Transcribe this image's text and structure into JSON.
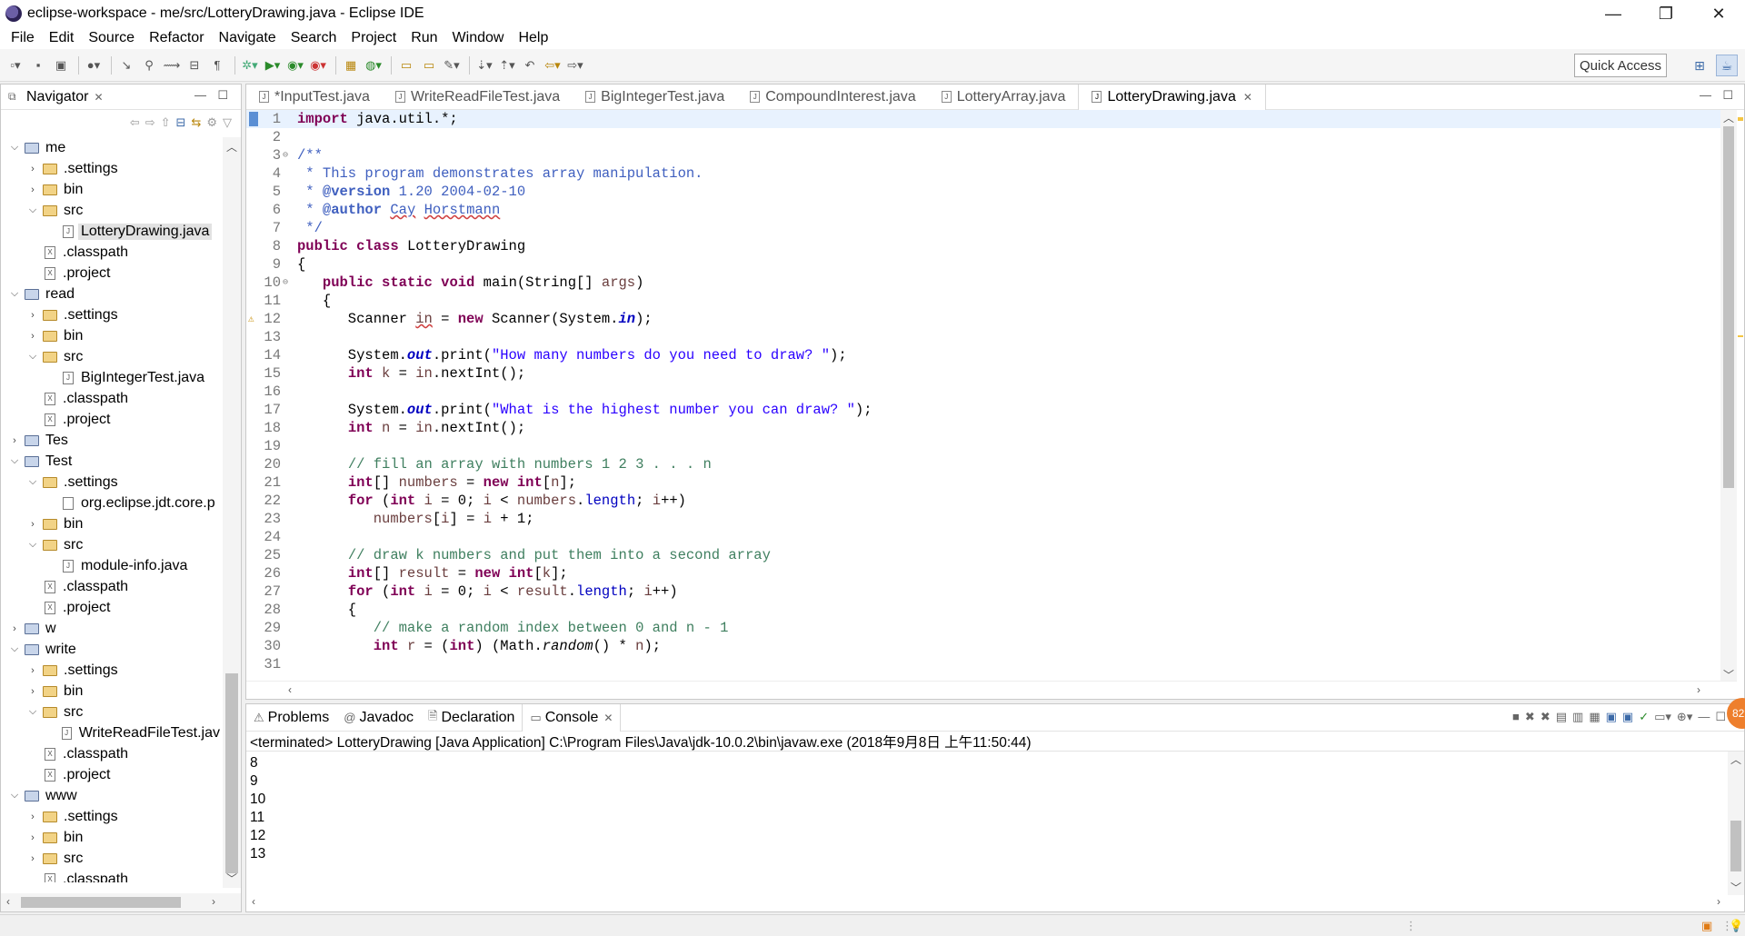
{
  "window": {
    "title": "eclipse-workspace - me/src/LotteryDrawing.java - Eclipse IDE",
    "minimize": "—",
    "restore": "❐",
    "close": "✕"
  },
  "menu": [
    "File",
    "Edit",
    "Source",
    "Refactor",
    "Navigate",
    "Search",
    "Project",
    "Run",
    "Window",
    "Help"
  ],
  "toolbar": {
    "quick_access": "Quick Access"
  },
  "navigator": {
    "title": "Navigator",
    "tree": [
      {
        "label": "me",
        "type": "project",
        "depth": 0,
        "state": "open"
      },
      {
        "label": ".settings",
        "type": "folder",
        "depth": 1,
        "state": "closed"
      },
      {
        "label": "bin",
        "type": "folder",
        "depth": 1,
        "state": "closed"
      },
      {
        "label": "src",
        "type": "folder",
        "depth": 1,
        "state": "open"
      },
      {
        "label": "LotteryDrawing.java",
        "type": "java",
        "depth": 2,
        "state": "leaf",
        "selected": true
      },
      {
        "label": ".classpath",
        "type": "xml",
        "depth": 1,
        "state": "leaf"
      },
      {
        "label": ".project",
        "type": "xml",
        "depth": 1,
        "state": "leaf"
      },
      {
        "label": "read",
        "type": "project",
        "depth": 0,
        "state": "open"
      },
      {
        "label": ".settings",
        "type": "folder",
        "depth": 1,
        "state": "closed"
      },
      {
        "label": "bin",
        "type": "folder",
        "depth": 1,
        "state": "closed"
      },
      {
        "label": "src",
        "type": "folder",
        "depth": 1,
        "state": "open"
      },
      {
        "label": "BigIntegerTest.java",
        "type": "java",
        "depth": 2,
        "state": "leaf"
      },
      {
        "label": ".classpath",
        "type": "xml",
        "depth": 1,
        "state": "leaf"
      },
      {
        "label": ".project",
        "type": "xml",
        "depth": 1,
        "state": "leaf"
      },
      {
        "label": "Tes",
        "type": "project",
        "depth": 0,
        "state": "closed"
      },
      {
        "label": "Test",
        "type": "project",
        "depth": 0,
        "state": "open"
      },
      {
        "label": ".settings",
        "type": "folder",
        "depth": 1,
        "state": "open"
      },
      {
        "label": "org.eclipse.jdt.core.p",
        "type": "file",
        "depth": 2,
        "state": "leaf"
      },
      {
        "label": "bin",
        "type": "folder",
        "depth": 1,
        "state": "closed"
      },
      {
        "label": "src",
        "type": "folder",
        "depth": 1,
        "state": "open"
      },
      {
        "label": "module-info.java",
        "type": "java",
        "depth": 2,
        "state": "leaf"
      },
      {
        "label": ".classpath",
        "type": "xml",
        "depth": 1,
        "state": "leaf"
      },
      {
        "label": ".project",
        "type": "xml",
        "depth": 1,
        "state": "leaf"
      },
      {
        "label": "w",
        "type": "project",
        "depth": 0,
        "state": "closed"
      },
      {
        "label": "write",
        "type": "project",
        "depth": 0,
        "state": "open"
      },
      {
        "label": ".settings",
        "type": "folder",
        "depth": 1,
        "state": "closed"
      },
      {
        "label": "bin",
        "type": "folder",
        "depth": 1,
        "state": "closed"
      },
      {
        "label": "src",
        "type": "folder",
        "depth": 1,
        "state": "open"
      },
      {
        "label": "WriteReadFileTest.jav",
        "type": "java",
        "depth": 2,
        "state": "leaf"
      },
      {
        "label": ".classpath",
        "type": "xml",
        "depth": 1,
        "state": "leaf"
      },
      {
        "label": ".project",
        "type": "xml",
        "depth": 1,
        "state": "leaf"
      },
      {
        "label": "www",
        "type": "project",
        "depth": 0,
        "state": "open"
      },
      {
        "label": ".settings",
        "type": "folder",
        "depth": 1,
        "state": "closed"
      },
      {
        "label": "bin",
        "type": "folder",
        "depth": 1,
        "state": "closed"
      },
      {
        "label": "src",
        "type": "folder",
        "depth": 1,
        "state": "closed"
      },
      {
        "label": ".classpath",
        "type": "xml",
        "depth": 1,
        "state": "leaf"
      }
    ]
  },
  "editor": {
    "tabs": [
      {
        "label": "*InputTest.java",
        "active": false
      },
      {
        "label": "WriteReadFileTest.java",
        "active": false
      },
      {
        "label": "BigIntegerTest.java",
        "active": false
      },
      {
        "label": "CompoundInterest.java",
        "active": false
      },
      {
        "label": "LotteryArray.java",
        "active": false
      },
      {
        "label": "LotteryDrawing.java",
        "active": true
      }
    ],
    "lines": [
      {
        "n": "1",
        "html": "<span class='kw'>import</span> java.util.*;",
        "current": true
      },
      {
        "n": "2",
        "html": ""
      },
      {
        "n": "3",
        "fold": true,
        "html": "<span class='jd'>/**</span>"
      },
      {
        "n": "4",
        "html": "<span class='jd'> * This program demonstrates array manipulation.</span>"
      },
      {
        "n": "5",
        "html": "<span class='jd'> * <b>@version</b> 1.20 2004-02-10</span>"
      },
      {
        "n": "6",
        "html": "<span class='jd'> * <b>@author</b> <span class='und'>Cay</span> <span class='und'>Horstmann</span></span>"
      },
      {
        "n": "7",
        "html": "<span class='jd'> */</span>"
      },
      {
        "n": "8",
        "html": "<span class='kw'>public</span> <span class='kw'>class</span> LotteryDrawing"
      },
      {
        "n": "9",
        "html": "{"
      },
      {
        "n": "10",
        "fold": true,
        "html": "   <span class='kw'>public</span> <span class='kw'>static</span> <span class='kw'>void</span> main(String[] <span class='var'>args</span>)"
      },
      {
        "n": "11",
        "html": "   {"
      },
      {
        "n": "12",
        "warn": true,
        "html": "      Scanner <span class='var und'>in</span> = <span class='kw'>new</span> Scanner(System.<span class='fld'>in</span>);"
      },
      {
        "n": "13",
        "html": ""
      },
      {
        "n": "14",
        "html": "      System.<span class='fld'>out</span>.print(<span class='str'>\"How many numbers do you need to draw? \"</span>);"
      },
      {
        "n": "15",
        "html": "      <span class='kw'>int</span> <span class='var'>k</span> = <span class='var'>in</span>.nextInt();"
      },
      {
        "n": "16",
        "html": ""
      },
      {
        "n": "17",
        "html": "      System.<span class='fld'>out</span>.print(<span class='str'>\"What is the highest number you can draw? \"</span>);"
      },
      {
        "n": "18",
        "html": "      <span class='kw'>int</span> <span class='var'>n</span> = <span class='var'>in</span>.nextInt();"
      },
      {
        "n": "19",
        "html": ""
      },
      {
        "n": "20",
        "html": "      <span class='cmt'>// fill an array with numbers 1 2 3 . . . n</span>"
      },
      {
        "n": "21",
        "html": "      <span class='kw'>int</span>[] <span class='var'>numbers</span> = <span class='kw'>new</span> <span class='kw'>int</span>[<span class='var'>n</span>];"
      },
      {
        "n": "22",
        "html": "      <span class='kw'>for</span> (<span class='kw'>int</span> <span class='var'>i</span> = 0; <span class='var'>i</span> &lt; <span class='var'>numbers</span>.<span class='fld' style='font-weight:normal;font-style:normal'>length</span>; <span class='var'>i</span>++)"
      },
      {
        "n": "23",
        "html": "         <span class='var'>numbers</span>[<span class='var'>i</span>] = <span class='var'>i</span> + 1;"
      },
      {
        "n": "24",
        "html": ""
      },
      {
        "n": "25",
        "html": "      <span class='cmt'>// draw k numbers and put them into a second array</span>"
      },
      {
        "n": "26",
        "html": "      <span class='kw'>int</span>[] <span class='var'>result</span> = <span class='kw'>new</span> <span class='kw'>int</span>[<span class='var'>k</span>];"
      },
      {
        "n": "27",
        "html": "      <span class='kw'>for</span> (<span class='kw'>int</span> <span class='var'>i</span> = 0; <span class='var'>i</span> &lt; <span class='var'>result</span>.<span class='fld' style='font-weight:normal;font-style:normal'>length</span>; <span class='var'>i</span>++)"
      },
      {
        "n": "28",
        "html": "      {"
      },
      {
        "n": "29",
        "html": "         <span class='cmt'>// make a random index between 0 and n - 1</span>"
      },
      {
        "n": "30",
        "html": "         <span class='kw'>int</span> <span class='var'>r</span> = (<span class='kw'>int</span>) (Math.<i>random</i>() * <span class='var'>n</span>);"
      },
      {
        "n": "31",
        "html": ""
      }
    ]
  },
  "bottom": {
    "tabs": [
      {
        "label": "Problems",
        "icon": "⚠",
        "active": false
      },
      {
        "label": "Javadoc",
        "icon": "@",
        "active": false
      },
      {
        "label": "Declaration",
        "icon": "🗎",
        "active": false
      },
      {
        "label": "Console",
        "icon": "▭",
        "active": true
      }
    ],
    "header": "<terminated> LotteryDrawing [Java Application] C:\\Program Files\\Java\\jdk-10.0.2\\bin\\javaw.exe (2018年9月8日 上午11:50:44)",
    "output": [
      "8",
      "9",
      "10",
      "11",
      "12",
      "13"
    ]
  },
  "badge": "82"
}
